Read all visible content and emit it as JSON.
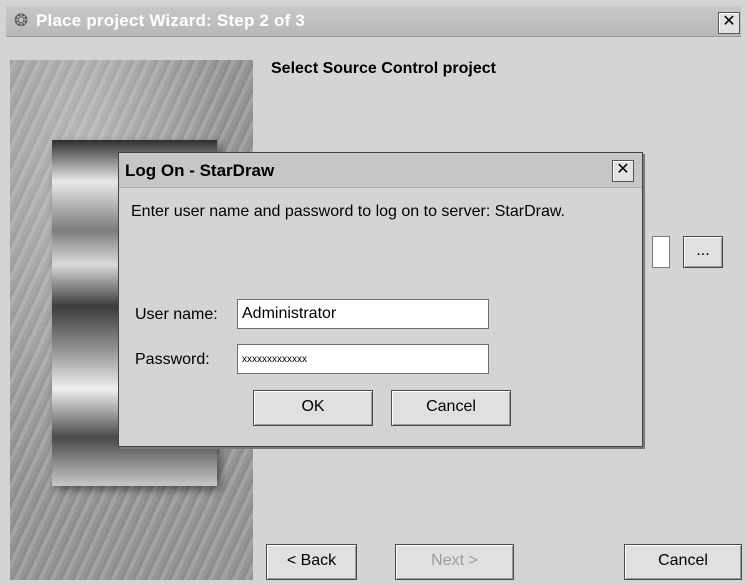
{
  "wizard": {
    "title": "Place project Wizard: Step 2 of 3",
    "close_label": "✕",
    "heading": "Select Source Control project",
    "browse_label": "...",
    "back_label": "< Back",
    "next_label": "Next >",
    "cancel_label": "Cancel"
  },
  "logon": {
    "title": "Log On - StarDraw",
    "close_label": "✕",
    "message": "Enter user name and password to log on to server: StarDraw.",
    "username_label": "User name:",
    "username_value": "Administrator",
    "password_label": "Password:",
    "password_value": "xxxxxxxxxxxxx",
    "ok_label": "OK",
    "cancel_label": "Cancel"
  }
}
